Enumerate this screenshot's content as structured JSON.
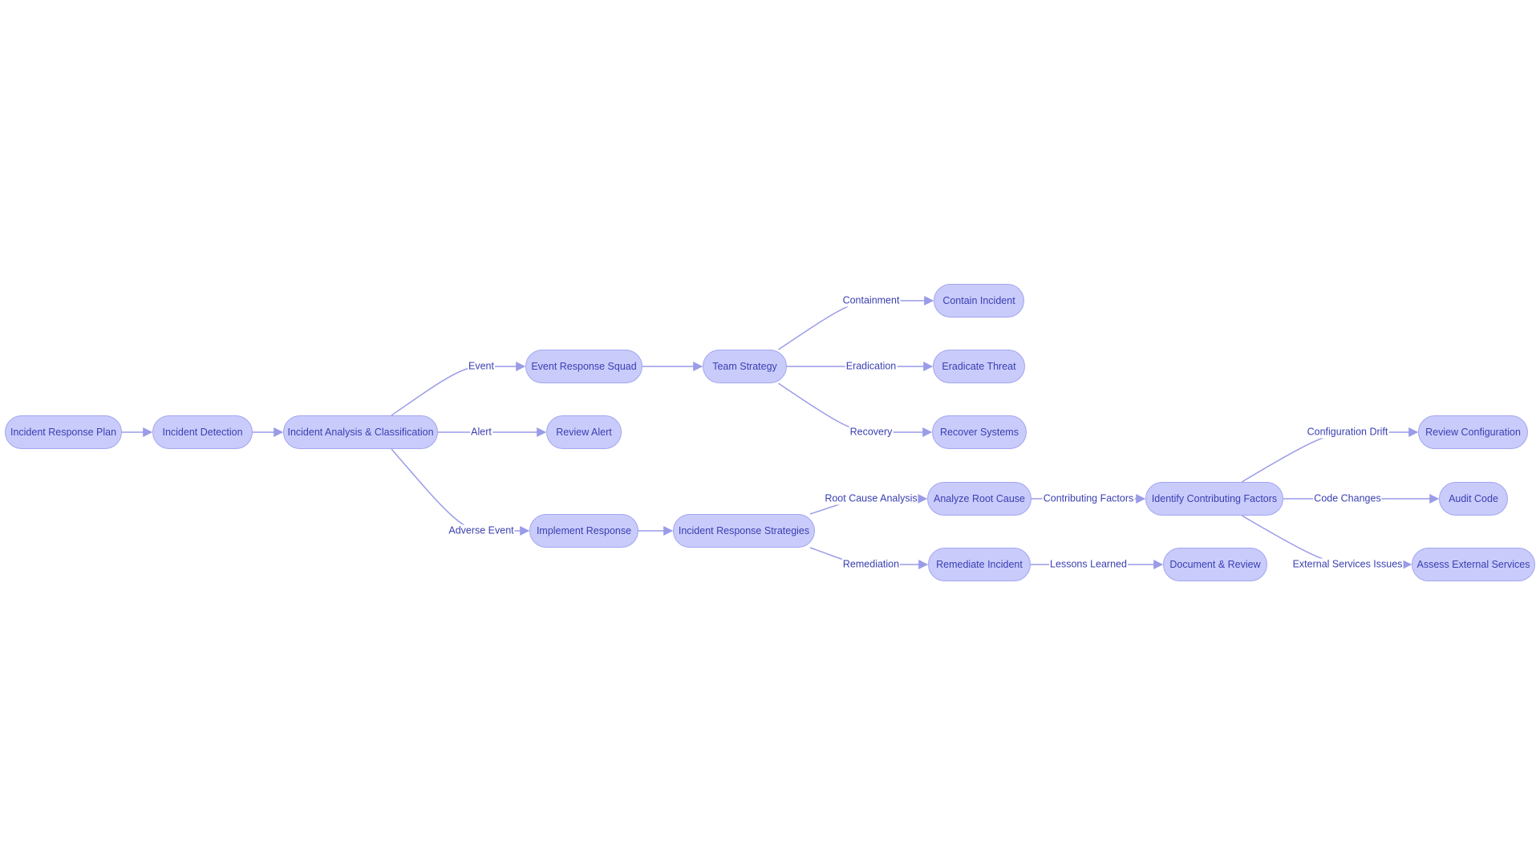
{
  "diagram": {
    "type": "flowchart",
    "colors": {
      "node_fill": "#c9cbfb",
      "node_stroke": "#a3a6f0",
      "text": "#3a3fb0",
      "edge": "#9a9ce8"
    },
    "nodes": [
      {
        "id": "A",
        "label": "Incident Response Plan"
      },
      {
        "id": "B",
        "label": "Incident Detection"
      },
      {
        "id": "C",
        "label": "Incident Analysis & Classification"
      },
      {
        "id": "D",
        "label": "Event Response Squad"
      },
      {
        "id": "E",
        "label": "Review Alert"
      },
      {
        "id": "F",
        "label": "Implement Response"
      },
      {
        "id": "G",
        "label": "Team Strategy"
      },
      {
        "id": "H",
        "label": "Incident Response Strategies"
      },
      {
        "id": "I",
        "label": "Contain Incident"
      },
      {
        "id": "J",
        "label": "Eradicate Threat"
      },
      {
        "id": "K",
        "label": "Recover Systems"
      },
      {
        "id": "L",
        "label": "Analyze Root Cause"
      },
      {
        "id": "M",
        "label": "Remediate Incident"
      },
      {
        "id": "N",
        "label": "Identify Contributing Factors"
      },
      {
        "id": "O",
        "label": "Document & Review"
      },
      {
        "id": "P",
        "label": "Review Configuration"
      },
      {
        "id": "Q",
        "label": "Audit Code"
      },
      {
        "id": "R",
        "label": "Assess External Services"
      }
    ],
    "edges": [
      {
        "from": "A",
        "to": "B",
        "label": ""
      },
      {
        "from": "B",
        "to": "C",
        "label": ""
      },
      {
        "from": "C",
        "to": "D",
        "label": "Event"
      },
      {
        "from": "C",
        "to": "E",
        "label": "Alert"
      },
      {
        "from": "C",
        "to": "F",
        "label": "Adverse Event"
      },
      {
        "from": "D",
        "to": "G",
        "label": ""
      },
      {
        "from": "F",
        "to": "H",
        "label": ""
      },
      {
        "from": "G",
        "to": "I",
        "label": "Containment"
      },
      {
        "from": "G",
        "to": "J",
        "label": "Eradication"
      },
      {
        "from": "G",
        "to": "K",
        "label": "Recovery"
      },
      {
        "from": "H",
        "to": "L",
        "label": "Root Cause Analysis"
      },
      {
        "from": "H",
        "to": "M",
        "label": "Remediation"
      },
      {
        "from": "L",
        "to": "N",
        "label": "Contributing Factors"
      },
      {
        "from": "M",
        "to": "O",
        "label": "Lessons Learned"
      },
      {
        "from": "N",
        "to": "P",
        "label": "Configuration Drift"
      },
      {
        "from": "N",
        "to": "Q",
        "label": "Code Changes"
      },
      {
        "from": "N",
        "to": "R",
        "label": "External Services Issues"
      }
    ]
  }
}
